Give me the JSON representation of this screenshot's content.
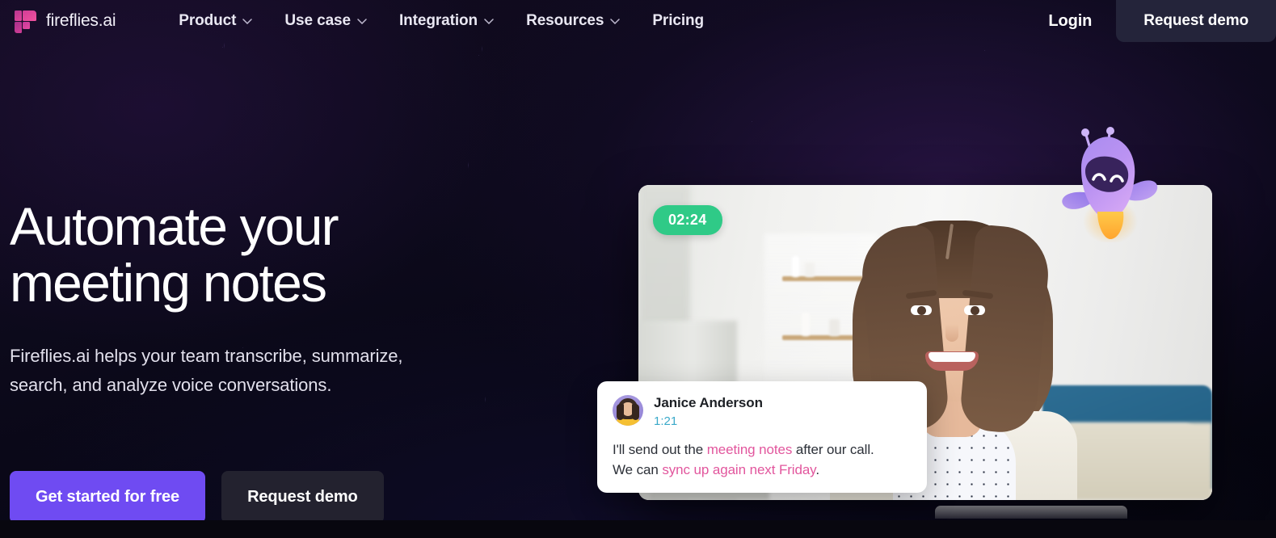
{
  "brand": {
    "name": "fireflies.ai",
    "logo_icon": "fireflies-logo-icon"
  },
  "nav": {
    "items": [
      {
        "label": "Product",
        "has_dropdown": true,
        "icon": "chevron-down-icon"
      },
      {
        "label": "Use case",
        "has_dropdown": true,
        "icon": "chevron-down-icon"
      },
      {
        "label": "Integration",
        "has_dropdown": true,
        "icon": "chevron-down-icon"
      },
      {
        "label": "Resources",
        "has_dropdown": true,
        "icon": "chevron-down-icon"
      },
      {
        "label": "Pricing",
        "has_dropdown": false,
        "icon": ""
      }
    ],
    "login_label": "Login",
    "demo_label": "Request demo"
  },
  "hero": {
    "headline_line1": "Automate your",
    "headline_line2": "meeting notes",
    "subhead": "Fireflies.ai helps your team transcribe, summarize, search, and analyze voice conversations.",
    "primary_cta": "Get started for free",
    "secondary_cta": "Request demo"
  },
  "video": {
    "time_badge": "02:24",
    "mascot_icon": "firefly-mascot-icon",
    "scene_alt": "woman smiling on video call in bedroom"
  },
  "caption": {
    "speaker": "Janice Anderson",
    "timestamp": "1:21",
    "line1_pre": "I'll send out the ",
    "line1_highlight": "meeting notes",
    "line1_post": " after our call.",
    "line2_pre": "We can ",
    "line2_highlight": "sync up again next Friday",
    "line2_post": ".",
    "avatar_icon": "speaker-avatar"
  },
  "colors": {
    "accent_purple": "#6f4bf2",
    "badge_green": "#2fca87",
    "highlight_pink": "#e2569d",
    "timestamp_teal": "#3aa9c9",
    "background_dark": "#0d0a1c",
    "nav_button_dark": "#24243a",
    "secondary_button_dark": "#23222f",
    "logo_magenta": "#e0459a"
  }
}
